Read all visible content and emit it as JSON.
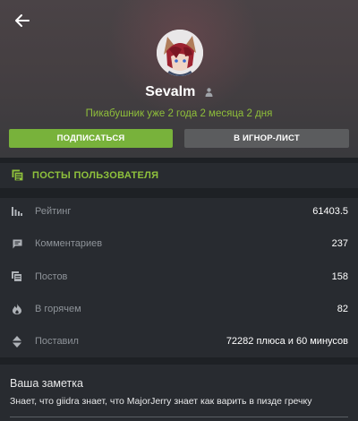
{
  "header": {
    "username": "Sevalm",
    "since": "Пикабушник уже 2 года 2 месяца 2 дня",
    "subscribe_label": "ПОДПИСАТЬСЯ",
    "ignore_label": "В ИГНОР-ЛИСТ"
  },
  "posts_section": {
    "label": "ПОСТЫ ПОЛЬЗОВАТЕЛЯ"
  },
  "stats": [
    {
      "icon": "rating-bars-icon",
      "label": "Рейтинг",
      "value": "61403.5"
    },
    {
      "icon": "comment-icon",
      "label": "Комментариев",
      "value": "237"
    },
    {
      "icon": "posts-icon",
      "label": "Постов",
      "value": "158"
    },
    {
      "icon": "fire-icon",
      "label": "В горячем",
      "value": "82"
    },
    {
      "icon": "vote-arrows-icon",
      "label": "Поставил",
      "value": "72282 плюса и 60 минусов"
    }
  ],
  "note": {
    "title": "Ваша заметка",
    "text": "Знает, что giidra знает, что MajorJerry знает как варить в пизде гречку"
  },
  "colors": {
    "accent_green": "#78b23b",
    "text_green": "#8fc23c",
    "card_bg": "#282b30",
    "page_bg": "#1e2125"
  }
}
